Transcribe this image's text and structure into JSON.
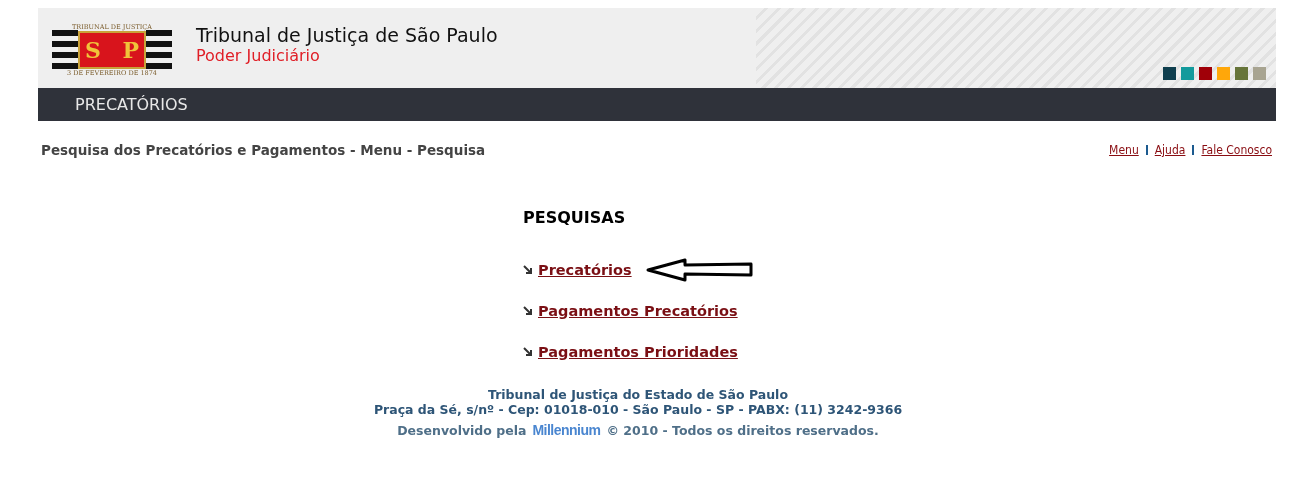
{
  "header": {
    "logo": {
      "top_text": "TRIBUNAL DE JUSTIÇA",
      "letters": [
        "S",
        "P"
      ],
      "bottom_text": "3 DE FEVEREIRO DE 1874"
    },
    "title": "Tribunal de Justiça de São Paulo",
    "subtitle": "Poder Judiciário",
    "theme_swatches": [
      {
        "color": "#0f3f4f"
      },
      {
        "color": "#139a9c"
      },
      {
        "color": "#a00008"
      },
      {
        "color": "#ffa70a"
      },
      {
        "color": "#67753a"
      },
      {
        "color": "#a8a491"
      }
    ]
  },
  "nav_bar": {
    "title": "PRECATÓRIOS"
  },
  "breadcrumb": "Pesquisa dos Precatórios e Pagamentos - Menu - Pesquisa",
  "top_links": [
    "Menu",
    "Ajuda",
    "Fale Conosco"
  ],
  "section_title": "PESQUISAS",
  "search_links": [
    {
      "label": "Precatórios",
      "pointed": true
    },
    {
      "label": "Pagamentos Precatórios",
      "pointed": false
    },
    {
      "label": "Pagamentos Prioridades",
      "pointed": false
    }
  ],
  "footer": {
    "lines": [
      "Tribunal de Justiça do Estado de São Paulo",
      "Praça da Sé, s/nº - Cep: 01018-010 - São Paulo - SP - PABX: (11) 3242-9366"
    ],
    "developed_by": "Desenvolvido pela",
    "brand": "Millennium",
    "copyright": "© 2010 - Todos os direitos reservados."
  }
}
